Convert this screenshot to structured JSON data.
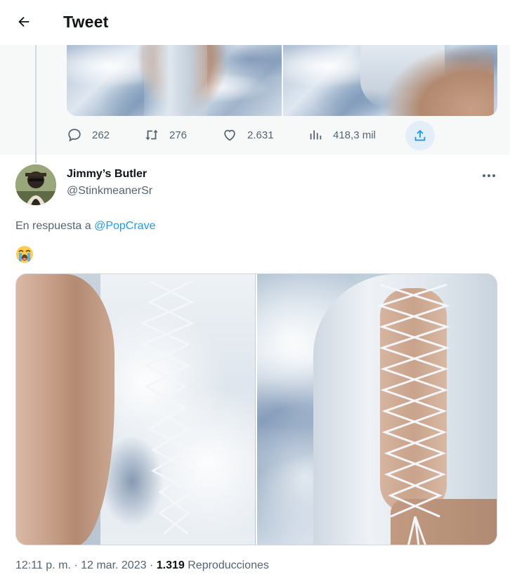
{
  "header": {
    "title": "Tweet",
    "back_icon": "arrow-left-icon"
  },
  "parent_tweet": {
    "actions": {
      "replies": "262",
      "retweets": "276",
      "likes": "2.631",
      "views": "418,3 mil"
    }
  },
  "tweet": {
    "display_name": "Jimmy’s Butler",
    "handle": "@StinkmeanerSr",
    "reply_prefix": "En respuesta a",
    "reply_to": "@PopCrave",
    "emoji_icon": "loudly-crying-face-icon",
    "time": "12:11 p. m.",
    "separator": "·",
    "date": "12 mar. 2023",
    "view_count": "1.319",
    "views_label": "Reproducciones"
  },
  "colors": {
    "accent": "#1d9bf0",
    "secondary_text": "#536471",
    "share_bg": "#e3eef8"
  }
}
